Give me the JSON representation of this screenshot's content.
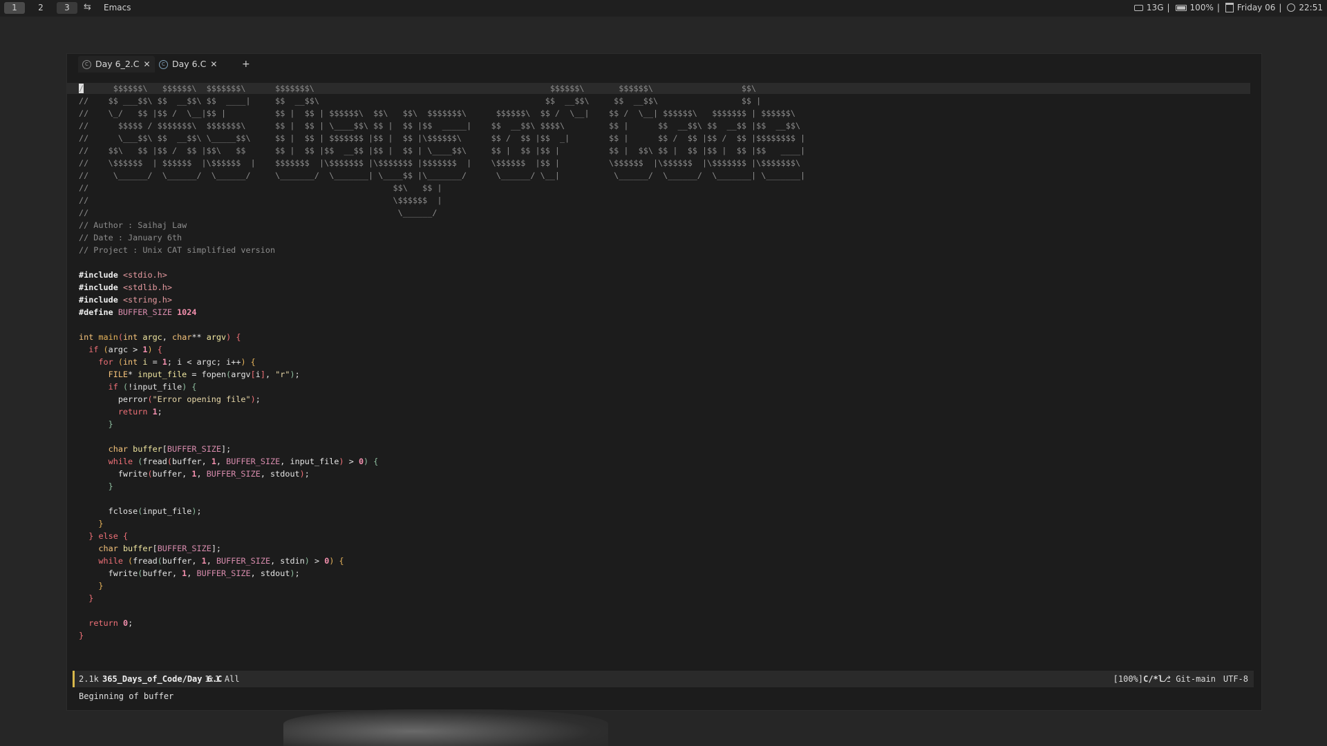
{
  "topbar": {
    "workspaces": [
      "1",
      "2",
      "3"
    ],
    "app_title": "Emacs",
    "disk": "13G",
    "battery": "100%",
    "date": "Friday 06",
    "time": "22:51",
    "sep": "|"
  },
  "tabs": [
    {
      "label": "Day 6_2.C",
      "icon": "c-file-icon",
      "active": false
    },
    {
      "label": "Day 6.C",
      "icon": "c-file-icon",
      "active": true
    }
  ],
  "new_tab_label": "+",
  "code": {
    "ascii": [
      "/      $$$$$$\\   $$$$$$\\  $$$$$$$\\      $$$$$$$\\                                                $$$$$$\\       $$$$$$\\                  $$\\",
      "//    $$ ___$$\\ $$  __$$\\ $$  ____|     $$  __$$\\                                              $$  __$$\\     $$  __$$\\                 $$ |",
      "//    \\_/   $$ |$$ /  \\__|$$ |          $$ |  $$ | $$$$$$\\  $$\\   $$\\  $$$$$$$\\      $$$$$$\\  $$ /  \\__|    $$ /  \\__| $$$$$$\\   $$$$$$$ | $$$$$$\\",
      "//      $$$$$ / $$$$$$$\\  $$$$$$$\\      $$ |  $$ | \\____$$\\ $$ |  $$ |$$  _____|    $$  __$$\\ $$$$\\         $$ |      $$  __$$\\ $$  __$$ |$$  __$$\\",
      "//      \\___$$\\ $$  __$$\\ \\_____$$\\     $$ |  $$ | $$$$$$$ |$$ |  $$ |\\$$$$$$\\      $$ /  $$ |$$  _|        $$ |      $$ /  $$ |$$ /  $$ |$$$$$$$$ |",
      "//    $$\\   $$ |$$ /  $$ |$$\\   $$      $$ |  $$ |$$  __$$ |$$ |  $$ | \\____$$\\     $$ |  $$ |$$ |          $$ |  $$\\ $$ |  $$ |$$ |  $$ |$$   ____|",
      "//    \\$$$$$$  | $$$$$$  |\\$$$$$$  |    $$$$$$$  |\\$$$$$$$ |\\$$$$$$$ |$$$$$$$  |    \\$$$$$$  |$$ |          \\$$$$$$  |\\$$$$$$  |\\$$$$$$$ |\\$$$$$$$\\",
      "//     \\______/  \\______/  \\______/     \\_______/  \\_______| \\____$$ |\\_______/      \\______/ \\__|           \\______/  \\______/  \\_______| \\_______|",
      "//                                                              $$\\   $$ |",
      "//                                                              \\$$$$$$  |",
      "//                                                               \\______/"
    ],
    "author": "// Author : Saihaj Law",
    "date": "// Date : January 6th",
    "project": "// Project : Unix CAT simplified version",
    "include_kw": "#include",
    "includes": [
      "<stdio.h>",
      "<stdlib.h>",
      "<string.h>"
    ],
    "define_kw": "#define",
    "define_name": "BUFFER_SIZE",
    "define_value": "1024",
    "return_value": "0"
  },
  "modeline": {
    "size": "2.1k",
    "path": "365_Days_of_Code/Day 6.C",
    "position": "1:1 All",
    "zoom": "[100%]",
    "mode": "C/*l",
    "git": "Git-main",
    "encoding": "UTF-8"
  },
  "echo_area": "Beginning of buffer"
}
